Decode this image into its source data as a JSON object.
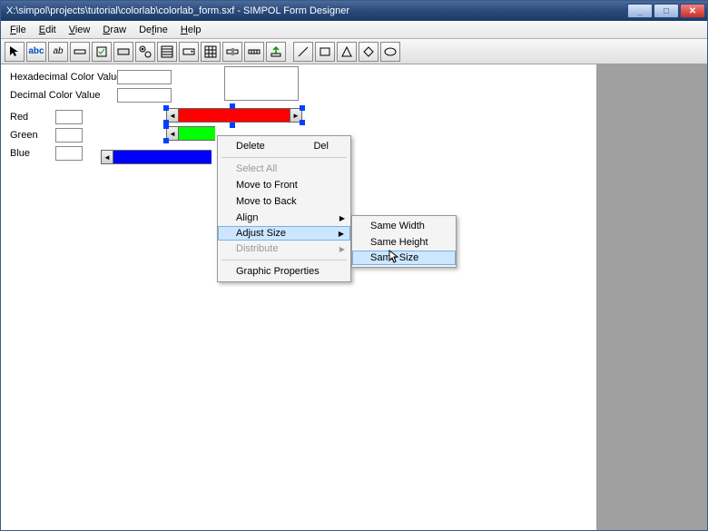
{
  "title": "X:\\simpol\\projects\\tutorial\\colorlab\\colorlab_form.sxf - SIMPOL Form Designer",
  "menus": {
    "file": "File",
    "edit": "Edit",
    "view": "View",
    "draw": "Draw",
    "define": "Define",
    "help": "Help"
  },
  "labels": {
    "hex": "Hexadecimal Color Value",
    "dec": "Decimal Color Value",
    "red": "Red",
    "green": "Green",
    "blue": "Blue"
  },
  "context": {
    "delete": "Delete",
    "delete_sc": "Del",
    "selectall": "Select All",
    "movefront": "Move to Front",
    "moveback": "Move to Back",
    "align": "Align",
    "adjustsize": "Adjust Size",
    "distribute": "Distribute",
    "graphic": "Graphic Properties"
  },
  "submenu": {
    "samewidth": "Same Width",
    "sameheight": "Same Height",
    "samesize": "Same Size"
  }
}
